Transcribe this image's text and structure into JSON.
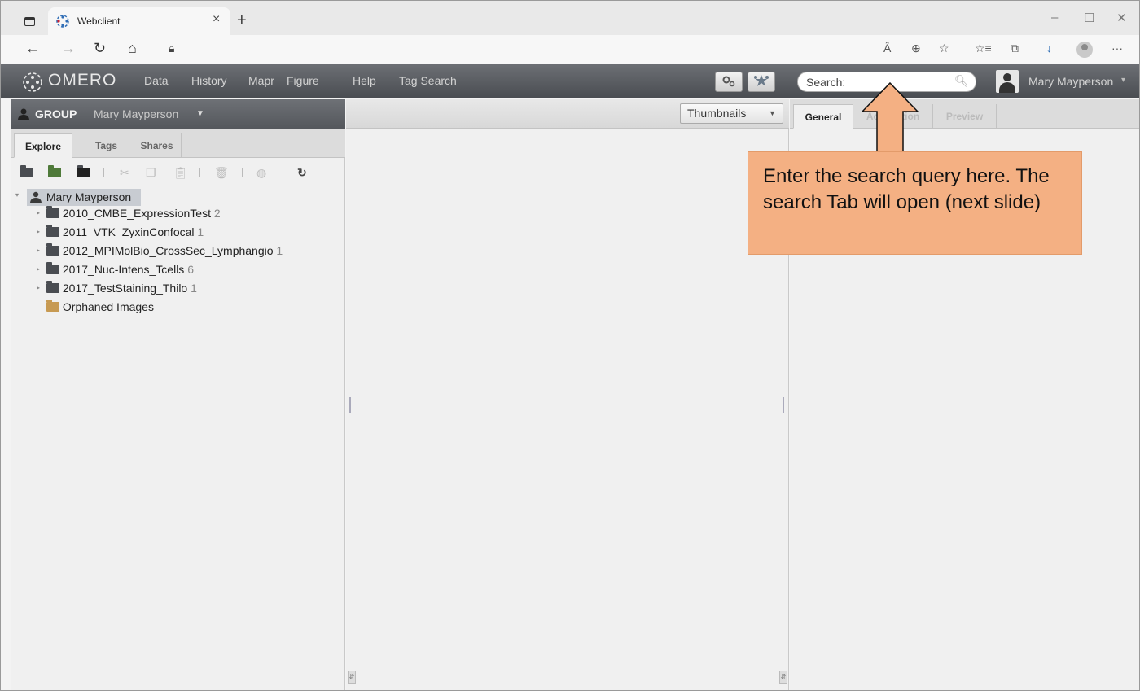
{
  "browser": {
    "tab_title": "Webclient",
    "tab_close": "×",
    "new_tab": "+",
    "window_controls": {
      "minimize": "–",
      "maximize": "☐",
      "close": "✕"
    },
    "nav": {
      "back": "←",
      "forward": "→",
      "reload": "↻",
      "home": "⌂"
    },
    "toolbar_icons": [
      "read-aloud-icon",
      "zoom-icon",
      "favorite-add-icon",
      "favorites-icon",
      "collections-icon",
      "downloads-icon",
      "profile-icon",
      "more-icon"
    ],
    "toolbar_glyphs": {
      "read_aloud": "Ȃ",
      "zoom": "⊕",
      "favorite_add": "☆",
      "favorites": "☆≡",
      "collections": "⧉",
      "downloads": "↓",
      "more": "···"
    }
  },
  "omero": {
    "brand": "OMERO",
    "menu": [
      "Data",
      "History",
      "Mapr",
      "Figure",
      "Help",
      "Tag Search"
    ],
    "search_placeholder": "Search:",
    "user_name": "Mary Mayperson",
    "caret": "▾"
  },
  "left": {
    "group_label": "GROUP",
    "group_owner": "Mary Mayperson",
    "tabs": [
      "Explore",
      "Tags",
      "Shares"
    ],
    "active_tab": "Explore",
    "tree": {
      "root": "Mary Mayperson",
      "items": [
        {
          "name": "2010_CMBE_ExpressionTest",
          "count": "2"
        },
        {
          "name": "2011_VTK_ZyxinConfocal",
          "count": "1"
        },
        {
          "name": "2012_MPIMolBio_CrossSec_Lymphangio",
          "count": "1"
        },
        {
          "name": "2017_Nuc-Intens_Tcells",
          "count": "6"
        },
        {
          "name": "2017_TestStaining_Thilo",
          "count": "1"
        }
      ],
      "orphaned": "Orphaned Images"
    }
  },
  "center": {
    "view_mode": "Thumbnails"
  },
  "right": {
    "tabs": [
      "General",
      "Acquisition",
      "Preview"
    ],
    "active_tab": "General"
  },
  "annotation": {
    "callout_text": "Enter the search query here. The search Tab will open (next slide)",
    "fill_color": "#f4b083"
  }
}
